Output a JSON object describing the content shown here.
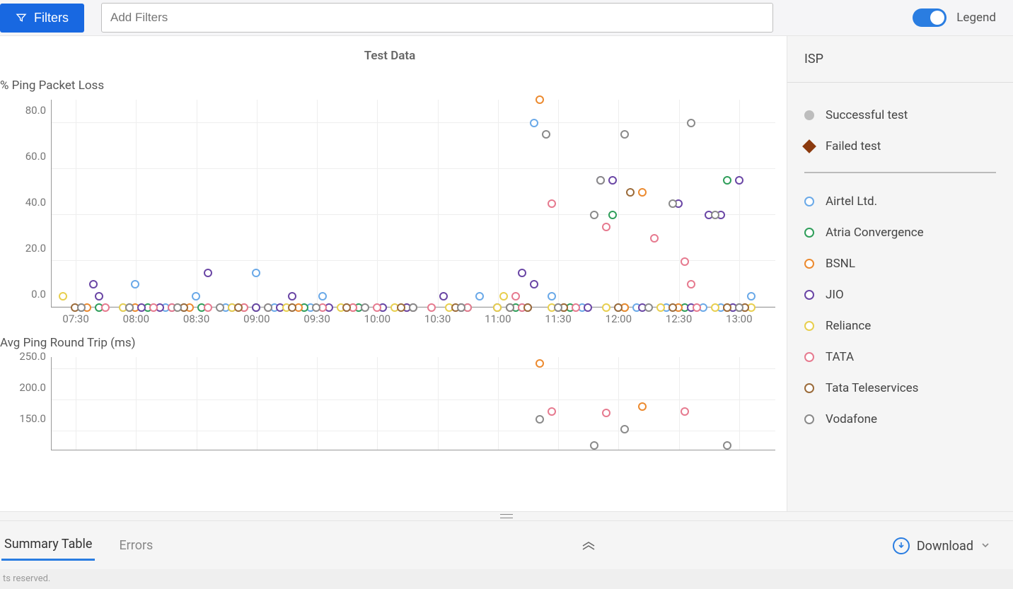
{
  "topbar": {
    "filters_button": "Filters",
    "filters_placeholder": "Add Filters",
    "legend_label": "Legend",
    "legend_on": true
  },
  "chart_title": "Test Data",
  "chart1_label": "% Ping Packet Loss",
  "chart2_label": "Avg Ping Round Trip (ms)",
  "legend_panel": {
    "title": "ISP",
    "status": [
      {
        "label": "Successful test",
        "color": "#bdbdbd",
        "shape": "filled-circle"
      },
      {
        "label": "Failed test",
        "color": "#8b3a0e",
        "shape": "diamond"
      }
    ],
    "isps": [
      {
        "name": "Airtel Ltd.",
        "color": "#6aa9e8"
      },
      {
        "name": "Atria Convergence",
        "color": "#2f9e5a"
      },
      {
        "name": "BSNL",
        "color": "#ec8a2f"
      },
      {
        "name": "JIO",
        "color": "#6a46a5"
      },
      {
        "name": "Reliance",
        "color": "#e8cf4e"
      },
      {
        "name": "TATA",
        "color": "#e67a8f"
      },
      {
        "name": "Tata Teleservices",
        "color": "#9b6b3a"
      },
      {
        "name": "Vodafone",
        "color": "#8a8a8a"
      }
    ]
  },
  "tabs": {
    "summary": "Summary Table",
    "errors": "Errors",
    "download": "Download"
  },
  "footer": "ts reserved.",
  "colors": {
    "Airtel": "#6aa9e8",
    "Atria": "#2f9e5a",
    "BSNL": "#ec8a2f",
    "JIO": "#6a46a5",
    "Reliance": "#e8cf4e",
    "TATA": "#e67a8f",
    "TataTS": "#9b6b3a",
    "Vodafone": "#8a8a8a"
  },
  "chart_data": [
    {
      "type": "scatter",
      "title": "% Ping Packet Loss",
      "xlabel": "",
      "ylabel": "% Ping Packet Loss",
      "xdomain": [
        7.3,
        13.3
      ],
      "ylim": [
        0,
        90
      ],
      "yticks": [
        0.0,
        20.0,
        40.0,
        60.0,
        80.0
      ],
      "xticks": [
        "07:30",
        "08:00",
        "08:30",
        "09:00",
        "09:30",
        "10:00",
        "10:30",
        "11:00",
        "11:30",
        "12:00",
        "12:30",
        "13:00"
      ],
      "series": [
        {
          "name": "Airtel Ltd.",
          "color": "#6aa9e8",
          "points": [
            [
              7.55,
              0
            ],
            [
              7.9,
              0
            ],
            [
              8.0,
              10
            ],
            [
              8.25,
              0
            ],
            [
              8.4,
              0
            ],
            [
              8.5,
              5
            ],
            [
              8.75,
              0
            ],
            [
              9.0,
              15
            ],
            [
              9.15,
              0
            ],
            [
              9.45,
              0
            ],
            [
              9.55,
              5
            ],
            [
              9.85,
              0
            ],
            [
              10.05,
              0
            ],
            [
              10.3,
              0
            ],
            [
              10.7,
              0
            ],
            [
              10.85,
              5
            ],
            [
              11.0,
              0
            ],
            [
              11.2,
              0
            ],
            [
              11.3,
              80
            ],
            [
              11.45,
              5
            ],
            [
              11.55,
              0
            ],
            [
              11.7,
              0
            ],
            [
              12.0,
              0
            ],
            [
              12.15,
              0
            ],
            [
              12.4,
              0
            ],
            [
              12.5,
              0
            ],
            [
              12.7,
              0
            ],
            [
              12.85,
              0
            ],
            [
              12.95,
              0
            ],
            [
              13.0,
              0
            ],
            [
              13.1,
              5
            ]
          ]
        },
        {
          "name": "Atria Convergence",
          "color": "#2f9e5a",
          "points": [
            [
              7.7,
              0
            ],
            [
              8.1,
              0
            ],
            [
              8.55,
              0
            ],
            [
              9.0,
              0
            ],
            [
              9.4,
              0
            ],
            [
              9.85,
              0
            ],
            [
              10.3,
              0
            ],
            [
              10.75,
              0
            ],
            [
              11.15,
              0
            ],
            [
              11.6,
              0
            ],
            [
              11.95,
              40
            ],
            [
              12.05,
              0
            ],
            [
              12.55,
              0
            ],
            [
              12.9,
              55
            ],
            [
              13.0,
              0
            ]
          ]
        },
        {
          "name": "BSNL",
          "color": "#ec8a2f",
          "points": [
            [
              7.6,
              0
            ],
            [
              8.0,
              0
            ],
            [
              8.45,
              0
            ],
            [
              8.9,
              0
            ],
            [
              9.35,
              0
            ],
            [
              9.8,
              0
            ],
            [
              10.25,
              0
            ],
            [
              10.7,
              0
            ],
            [
              11.1,
              0
            ],
            [
              11.35,
              90
            ],
            [
              11.55,
              0
            ],
            [
              12.05,
              0
            ],
            [
              12.2,
              50
            ],
            [
              12.5,
              0
            ],
            [
              12.9,
              0
            ],
            [
              13.05,
              0
            ]
          ]
        },
        {
          "name": "JIO",
          "color": "#6a46a5",
          "points": [
            [
              7.65,
              10
            ],
            [
              7.7,
              5
            ],
            [
              8.05,
              0
            ],
            [
              8.2,
              0
            ],
            [
              8.3,
              0
            ],
            [
              8.6,
              15
            ],
            [
              8.8,
              0
            ],
            [
              9.0,
              0
            ],
            [
              9.2,
              0
            ],
            [
              9.3,
              5
            ],
            [
              9.6,
              0
            ],
            [
              9.75,
              0
            ],
            [
              10.05,
              0
            ],
            [
              10.25,
              0
            ],
            [
              10.55,
              5
            ],
            [
              10.7,
              0
            ],
            [
              11.0,
              0
            ],
            [
              11.2,
              15
            ],
            [
              11.25,
              0
            ],
            [
              11.3,
              10
            ],
            [
              11.5,
              0
            ],
            [
              11.75,
              0
            ],
            [
              11.85,
              55
            ],
            [
              11.95,
              55
            ],
            [
              12.2,
              0
            ],
            [
              12.5,
              45
            ],
            [
              12.6,
              0
            ],
            [
              12.75,
              40
            ],
            [
              12.85,
              40
            ],
            [
              12.95,
              0
            ],
            [
              13.0,
              55
            ]
          ]
        },
        {
          "name": "Reliance",
          "color": "#e8cf4e",
          "points": [
            [
              7.4,
              5
            ],
            [
              7.9,
              0
            ],
            [
              8.35,
              0
            ],
            [
              8.8,
              0
            ],
            [
              9.25,
              0
            ],
            [
              9.7,
              0
            ],
            [
              10.15,
              0
            ],
            [
              10.6,
              0
            ],
            [
              11.0,
              0
            ],
            [
              11.05,
              5
            ],
            [
              11.45,
              0
            ],
            [
              11.9,
              0
            ],
            [
              12.35,
              0
            ],
            [
              12.8,
              0
            ],
            [
              13.1,
              0
            ]
          ]
        },
        {
          "name": "TATA",
          "color": "#e67a8f",
          "points": [
            [
              7.75,
              0
            ],
            [
              8.15,
              0
            ],
            [
              8.3,
              0
            ],
            [
              8.6,
              0
            ],
            [
              8.9,
              0
            ],
            [
              9.1,
              0
            ],
            [
              9.55,
              0
            ],
            [
              9.8,
              0
            ],
            [
              10.0,
              0
            ],
            [
              10.3,
              0
            ],
            [
              10.45,
              0
            ],
            [
              10.75,
              0
            ],
            [
              11.15,
              5
            ],
            [
              11.2,
              0
            ],
            [
              11.45,
              45
            ],
            [
              11.65,
              0
            ],
            [
              11.9,
              35
            ],
            [
              12.3,
              30
            ],
            [
              12.55,
              20
            ],
            [
              12.6,
              10
            ],
            [
              12.65,
              0
            ],
            [
              13.0,
              0
            ]
          ]
        },
        {
          "name": "Tata Teleservices",
          "color": "#9b6b3a",
          "points": [
            [
              7.5,
              0
            ],
            [
              7.95,
              0
            ],
            [
              8.4,
              0
            ],
            [
              8.85,
              0
            ],
            [
              9.3,
              0
            ],
            [
              9.75,
              0
            ],
            [
              10.2,
              0
            ],
            [
              10.65,
              0
            ],
            [
              11.1,
              0
            ],
            [
              11.25,
              0
            ],
            [
              11.55,
              0
            ],
            [
              12.0,
              0
            ],
            [
              12.1,
              50
            ],
            [
              12.45,
              0
            ],
            [
              12.9,
              0
            ],
            [
              13.05,
              0
            ]
          ]
        },
        {
          "name": "Vodafone",
          "color": "#8a8a8a",
          "points": [
            [
              7.55,
              0
            ],
            [
              7.95,
              0
            ],
            [
              8.35,
              0
            ],
            [
              8.7,
              0
            ],
            [
              9.1,
              0
            ],
            [
              9.5,
              0
            ],
            [
              9.9,
              0
            ],
            [
              10.3,
              0
            ],
            [
              10.7,
              0
            ],
            [
              11.1,
              0
            ],
            [
              11.4,
              75
            ],
            [
              11.5,
              0
            ],
            [
              11.8,
              40
            ],
            [
              11.85,
              55
            ],
            [
              12.05,
              75
            ],
            [
              12.25,
              0
            ],
            [
              12.45,
              45
            ],
            [
              12.6,
              80
            ],
            [
              12.8,
              40
            ],
            [
              13.0,
              0
            ]
          ]
        }
      ]
    },
    {
      "type": "scatter",
      "title": "Avg Ping Round Trip (ms)",
      "xlabel": "",
      "ylabel": "Avg Ping Round Trip (ms)",
      "xdomain": [
        7.3,
        13.3
      ],
      "ylim": [
        120,
        270
      ],
      "yticks": [
        150.0,
        200.0,
        250.0
      ],
      "xticks": [
        "07:30",
        "08:00",
        "08:30",
        "09:00",
        "09:30",
        "10:00",
        "10:30",
        "11:00",
        "11:30",
        "12:00",
        "12:30",
        "13:00"
      ],
      "series": [
        {
          "name": "BSNL",
          "color": "#ec8a2f",
          "points": [
            [
              11.35,
              260
            ],
            [
              12.2,
              190
            ]
          ]
        },
        {
          "name": "TATA",
          "color": "#e67a8f",
          "points": [
            [
              11.45,
              182
            ],
            [
              11.9,
              180
            ],
            [
              12.55,
              182
            ]
          ]
        },
        {
          "name": "Vodafone",
          "color": "#8a8a8a",
          "points": [
            [
              11.35,
              170
            ],
            [
              11.8,
              128
            ],
            [
              12.05,
              154
            ],
            [
              12.9,
              128
            ]
          ]
        }
      ]
    }
  ]
}
